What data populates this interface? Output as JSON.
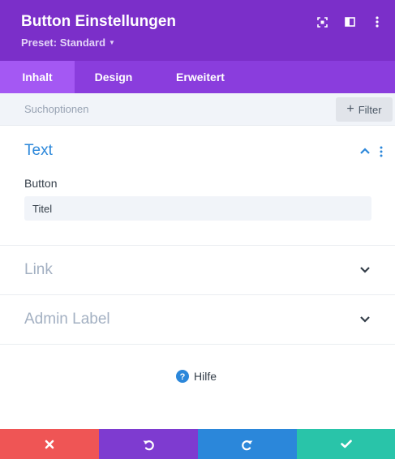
{
  "header": {
    "title": "Button Einstellungen",
    "preset": "Preset: Standard",
    "icons": [
      "fullscreen-icon",
      "split-view-icon",
      "more-options-icon"
    ]
  },
  "tabs": [
    {
      "label": "Inhalt",
      "active": true
    },
    {
      "label": "Design",
      "active": false
    },
    {
      "label": "Erweitert",
      "active": false
    }
  ],
  "search": {
    "placeholder": "Suchoptionen",
    "filter_label": "Filter"
  },
  "sections": {
    "text": {
      "title": "Text",
      "expanded": true,
      "field_label": "Button",
      "field_value": "Titel"
    },
    "link": {
      "title": "Link",
      "expanded": false
    },
    "admin": {
      "title": "Admin Label",
      "expanded": false
    }
  },
  "help": {
    "label": "Hilfe"
  },
  "footer": {
    "buttons": [
      "cancel",
      "undo",
      "redo",
      "save"
    ]
  },
  "colors": {
    "header": "#7b2fc9",
    "tabs": "#8a3ddd",
    "active_tab": "#a458f3",
    "section_active": "#2b87da",
    "cancel": "#ef5555",
    "undo": "#7e3bd0",
    "redo": "#2b87da",
    "save": "#29c4a9"
  }
}
